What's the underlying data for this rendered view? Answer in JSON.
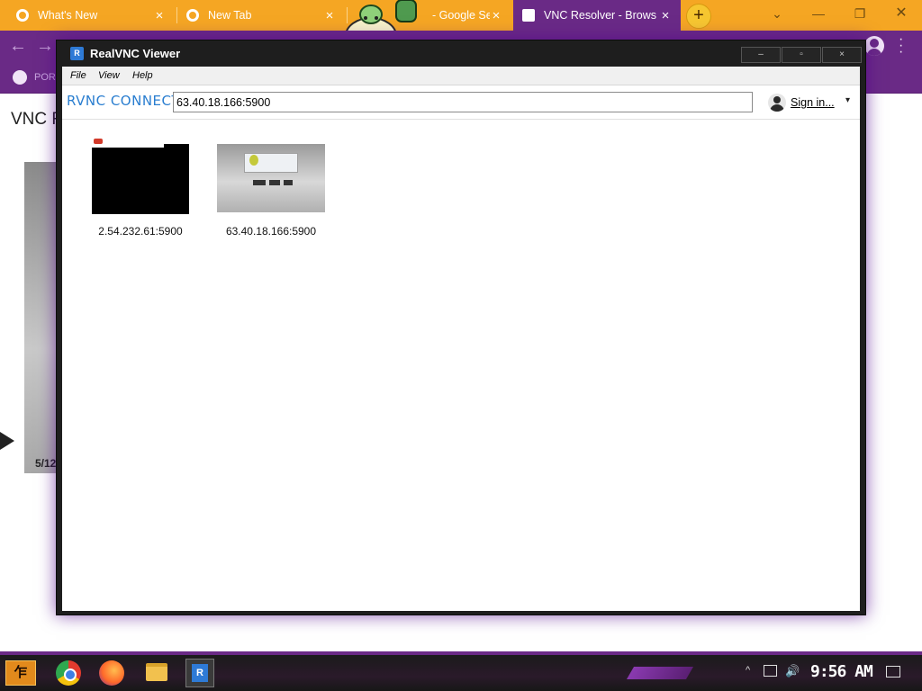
{
  "browser": {
    "tabs": [
      {
        "title": "What's New",
        "close": "×"
      },
      {
        "title": "New Tab",
        "close": "×"
      },
      {
        "title": "- Google Se",
        "close": "×"
      },
      {
        "title": "VNC Resolver - Brows",
        "close": "×"
      }
    ],
    "new_tab_symbol": "+",
    "window_controls": {
      "minimize": "—",
      "restore": "❐",
      "close": "✕",
      "dropdown": "⌄"
    },
    "nav": {
      "back": "←",
      "forward": "→"
    },
    "bookmark_label": "POR",
    "accent_color": "#6a2a86",
    "tab_color": "#f5a623"
  },
  "page": {
    "title": "VNC Re",
    "counter": "5/12"
  },
  "vnc_window": {
    "title": "RealVNC Viewer",
    "app_icon_letter": "R",
    "controls": {
      "minimize": "–",
      "maximize": "▫",
      "close": "×"
    },
    "menu": [
      "File",
      "View",
      "Help"
    ],
    "brand": "RVNC CONNECT",
    "address_value": "63.40.18.166:5900",
    "sign_in": "Sign in...",
    "sign_in_arrow": "▾",
    "connections": [
      {
        "label": "2.54.232.61:5900",
        "thumbnail": "black-screen"
      },
      {
        "label": "63.40.18.166:5900",
        "thumbnail": "grey-desktop"
      }
    ]
  },
  "taskbar": {
    "start_label": "乍",
    "apps": [
      "chrome-icon",
      "firefox-icon",
      "file-explorer-icon",
      "realvnc-icon"
    ],
    "tray_up": "^",
    "volume": "🔊",
    "clock": "9:56 AM"
  }
}
